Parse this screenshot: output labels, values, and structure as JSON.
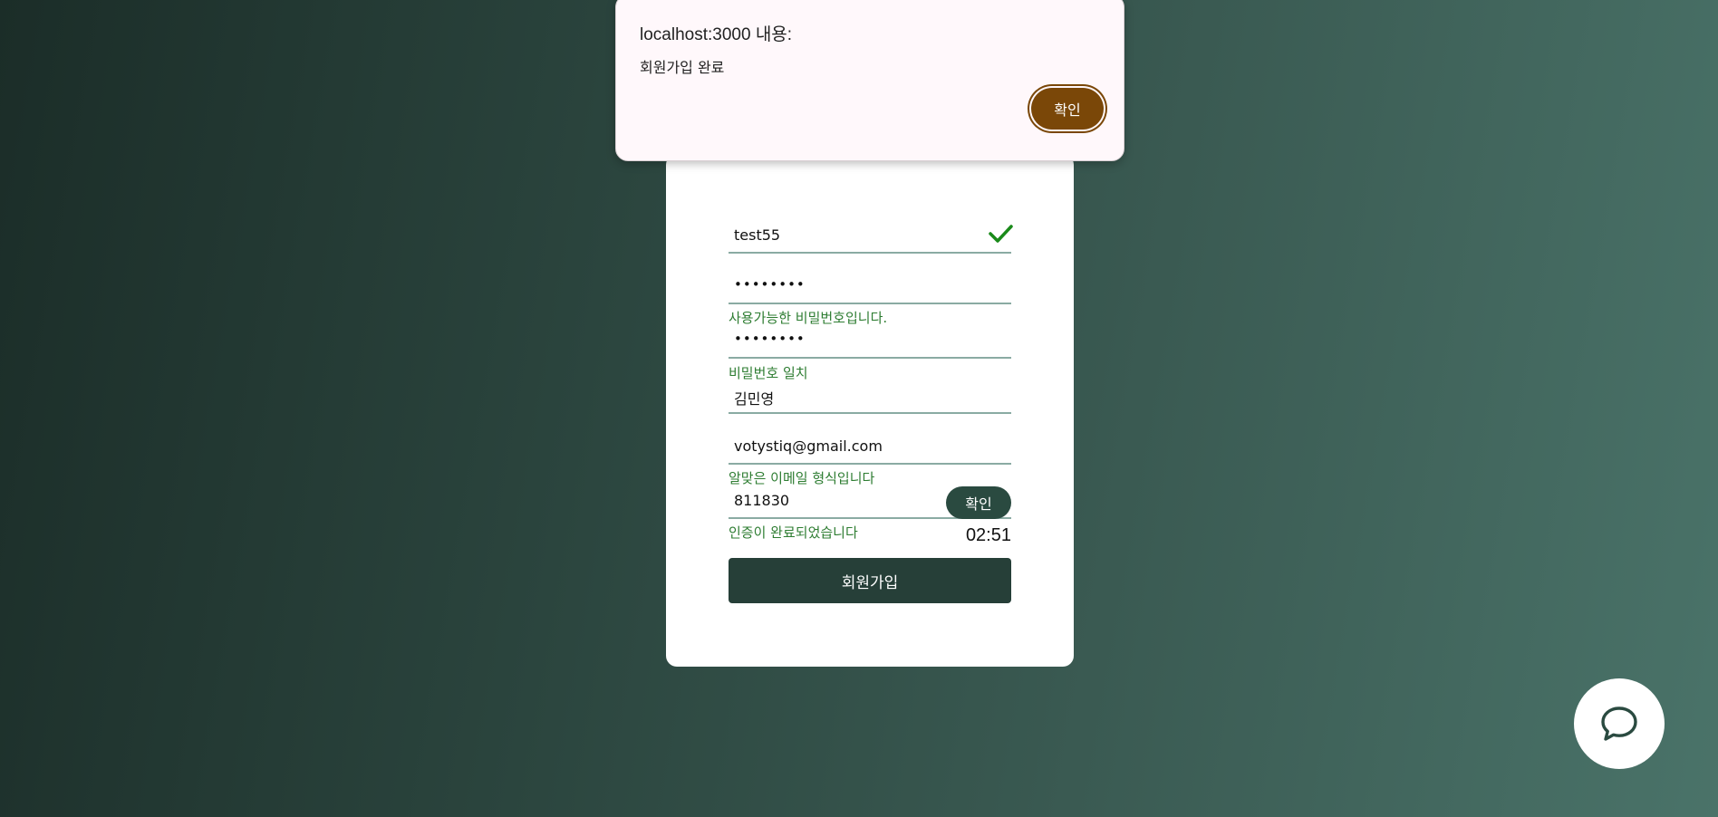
{
  "dialog": {
    "title": "localhost:3000 내용:",
    "message": "회원가입 완료",
    "ok_label": "확인"
  },
  "form": {
    "username": {
      "value": "test55",
      "valid_icon": "check-icon",
      "valid_color": "#1a8a1a"
    },
    "password": {
      "value": "••••••••",
      "hint": "사용가능한 비밀번호입니다."
    },
    "password_confirm": {
      "value": "••••••••",
      "hint": "비밀번호 일치"
    },
    "name": {
      "value": "김민영"
    },
    "email": {
      "value": "votystiq@gmail.com",
      "hint": "알맞은 이메일 형식입니다"
    },
    "verification": {
      "value": "811830",
      "button_label": "확인",
      "hint": "인증이 완료되었습니다",
      "timer": "02:51"
    },
    "submit_label": "회원가입"
  },
  "chat_button": {
    "icon": "chat-bubble-icon"
  },
  "colors": {
    "hint_green": "#2e7d32",
    "primary_dark": "#263f38",
    "dialog_button": "#7a4708"
  }
}
